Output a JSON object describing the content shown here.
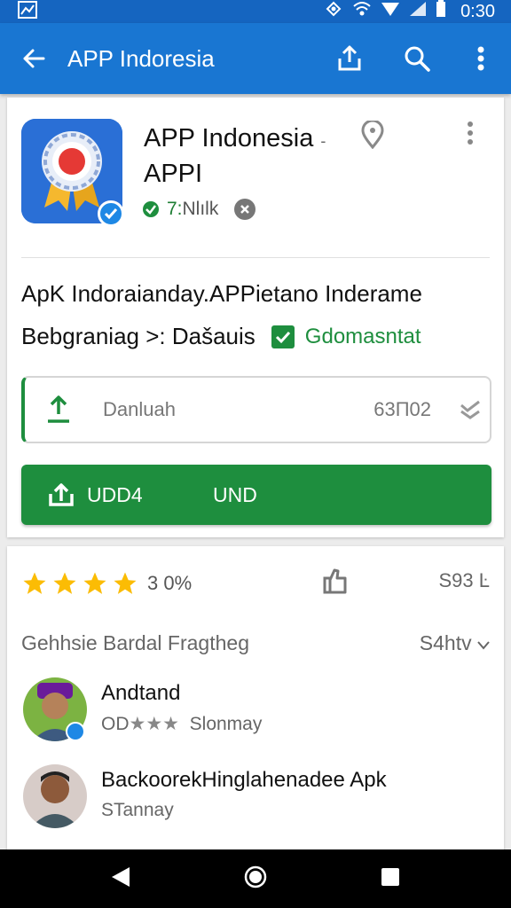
{
  "status_bar": {
    "time": "0:30"
  },
  "app_bar": {
    "title": "APP Indoresia"
  },
  "app": {
    "name": "APP Indonesia",
    "name_suffix": "-",
    "subtitle": "APPI",
    "downloads": "7:",
    "downloads_rest": "Nlılk"
  },
  "description": {
    "line1": "ApK Indoraianday.APPietano Inderame",
    "line2": "Bebgraniag >: Dašauis",
    "verified_text": "Gdomasntat"
  },
  "download_box": {
    "label": "Danluah",
    "size": "63П02"
  },
  "install_button": {
    "label1": "UDD4",
    "label2": "UND"
  },
  "ratings": {
    "stars_filled": 4,
    "percent": "3 0%",
    "count": "S93 Ŀ"
  },
  "reviews_section": {
    "title": "Gehhsie Bardal Fragtheg",
    "sort": "S4htv"
  },
  "reviews": [
    {
      "name": "Andtand",
      "rating_text": "OD",
      "stars": "★★★",
      "sub": "Slonmay"
    },
    {
      "name": "BackoorekHinglahenadee Apk",
      "rating_text": "",
      "stars": "",
      "sub": "STannay"
    }
  ],
  "colors": {
    "status_bar": "#1565c0",
    "app_bar": "#1976d2",
    "install_green": "#1e8e3e",
    "star": "#fbbc04"
  }
}
